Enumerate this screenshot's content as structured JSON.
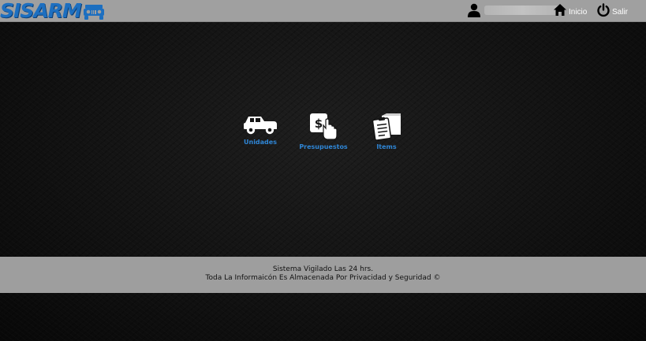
{
  "header": {
    "logo_text": "SISARM",
    "user_name": "",
    "nav": {
      "home_label": "Inicio",
      "logout_label": "Salir"
    }
  },
  "menu": {
    "items": [
      {
        "label": "Unidades",
        "icon": "jeep-icon"
      },
      {
        "label": "Presupuestos",
        "icon": "budget-hand-icon"
      },
      {
        "label": "Items",
        "icon": "clipboard-box-icon"
      }
    ]
  },
  "footer": {
    "line1": "Sistema Vigilado Las 24 hrs.",
    "line2": "Toda La Informaicón Es Almacenada Por Privacidad y Seguridad ©"
  },
  "colors": {
    "accent": "#2f86d6",
    "logo": "#1d6fc0",
    "bar": "#a0a0a0",
    "background": "#121212"
  }
}
